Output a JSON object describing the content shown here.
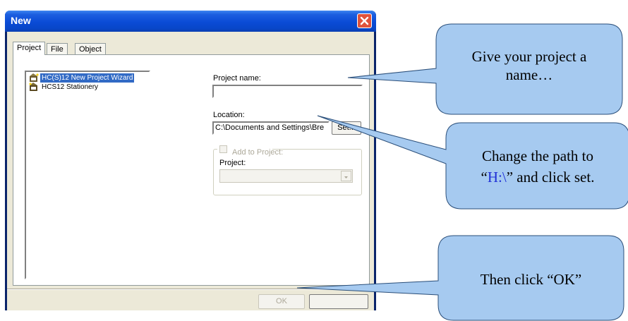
{
  "dialog": {
    "title": "New",
    "tabs": [
      "Project",
      "File",
      "Object"
    ],
    "templates": [
      {
        "label": "HC(S)12 New Project Wizard",
        "selected": true,
        "icon": "wizard-icon"
      },
      {
        "label": "HCS12 Stationery",
        "selected": false,
        "icon": "stationery-icon"
      }
    ],
    "project_name": {
      "label": "Project name:",
      "value": ""
    },
    "location": {
      "label": "Location:",
      "value": "C:\\Documents and Settings\\Bre",
      "set_label": "Set..."
    },
    "add_to_project": {
      "label": "Add to Project:",
      "project_label": "Project:"
    },
    "ok_label": "OK"
  },
  "callouts": {
    "c1_line1": "Give your project a",
    "c1_line2": "name…",
    "c2_line1": "Change the path to",
    "c2_open": "“",
    "c2_path": "H:\\",
    "c2_close": "” and click set.",
    "c3": "Then click “OK”"
  },
  "colors": {
    "callout_fill": "#a6caf0",
    "callout_stroke": "#2b4f7a",
    "title_bar": "#0a4bd6",
    "highlight": "#1f2fd6"
  }
}
